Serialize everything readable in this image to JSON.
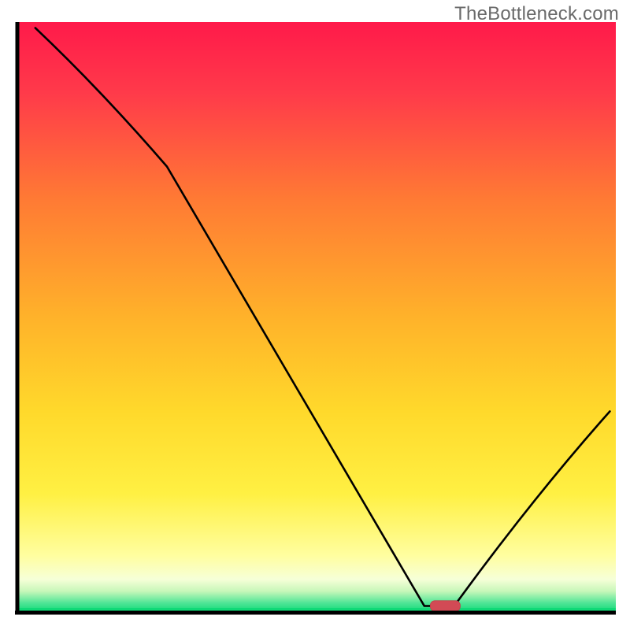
{
  "watermark": "TheBottleneck.com",
  "colors": {
    "gradient_top": "#ff1a4a",
    "gradient_mid_up": "#ff8a2e",
    "gradient_mid": "#ffd92b",
    "gradient_low": "#fff56a",
    "gradient_pale": "#fdffd6",
    "gradient_bottom": "#10d977",
    "axis": "#000000",
    "line": "#000000",
    "marker_fill": "#d24a55",
    "marker_stroke": "#c23b46"
  },
  "chart_data": {
    "type": "line",
    "title": "",
    "xlabel": "",
    "ylabel": "",
    "xlim": [
      0,
      100
    ],
    "ylim": [
      0,
      100
    ],
    "x": [
      3,
      25,
      68,
      73,
      99
    ],
    "values": [
      99,
      75.5,
      1,
      1,
      34
    ],
    "marker": {
      "x_center": 71.5,
      "y": 1,
      "width": 5,
      "height": 1.8
    },
    "notes": "V-shaped bottleneck curve over rainbow gradient background; minimum (optimal point) marked by small red pill near x≈71."
  }
}
